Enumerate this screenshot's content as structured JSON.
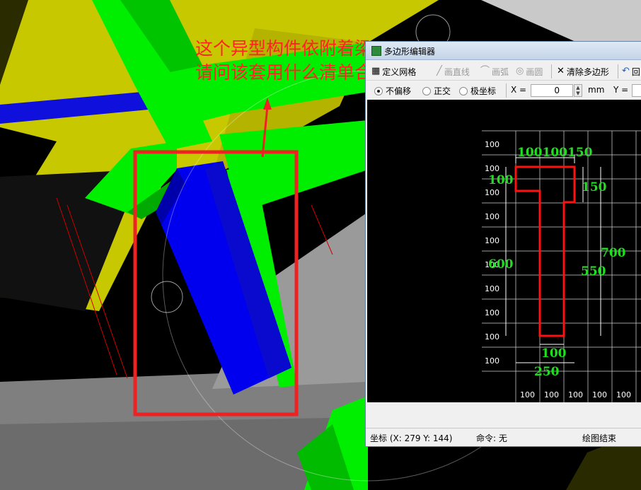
{
  "annotation": {
    "line1": "这个异型构件依附着梁",
    "line2": "请问该套用什么清单合适呢？"
  },
  "editor": {
    "title": "多边形编辑器",
    "toolbar": {
      "define_grid": "定义网格",
      "draw_line": "画直线",
      "draw_arc": "画弧",
      "draw_circle": "画圆",
      "clear_polygon": "清除多边形",
      "undo": "回"
    },
    "options": {
      "no_offset": "不偏移",
      "orthogonal": "正交",
      "polar": "极坐标",
      "x_label": "X =",
      "x_value": "0",
      "unit": "mm",
      "y_label": "Y ="
    },
    "canvas": {
      "row_labels": [
        "100",
        "100",
        "100",
        "100",
        "100",
        "100",
        "100",
        "100",
        "100",
        "100"
      ],
      "col_labels": [
        "100",
        "100",
        "100",
        "100",
        "100"
      ],
      "dim_top": "100100150",
      "dim_left_100": "100",
      "dim_right_150": "150",
      "dim_left_600": "600",
      "dim_right_550": "550",
      "dim_right_700": "700",
      "dim_bottom_100": "100",
      "dim_bottom_250": "250"
    },
    "status": {
      "coord": "坐标 (X: 279 Y: 144)",
      "command": "命令: 无",
      "state": "绘图结束"
    }
  },
  "colors": {
    "beam_green": "#00ee00",
    "column_blue": "#0000ee",
    "slab_yellow": "#c8c800",
    "highlight_red": "#ee2222",
    "shape_red": "#ff0000",
    "dim_green": "#22dd22"
  }
}
